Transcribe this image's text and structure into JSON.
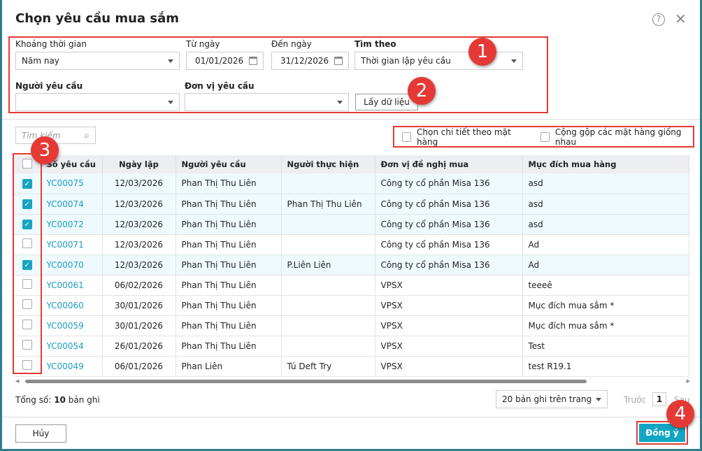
{
  "title": "Chọn yêu cầu mua sắm",
  "filters": {
    "period_label": "Khoảng thời gian",
    "period_value": "Năm nay",
    "from_label": "Từ ngày",
    "from_value": "01/01/2026",
    "to_label": "Đến ngày",
    "to_value": "31/12/2026",
    "search_by_label": "Tìm theo",
    "search_by_value": "Thời gian lập yêu cầu",
    "requester_label": "Người yêu cầu",
    "requester_value": "",
    "unit_label": "Đơn vị yêu cầu",
    "unit_value": "",
    "fetch_button": "Lấy dữ liệu"
  },
  "search_placeholder": "Tìm kiếm",
  "options": {
    "detail_by_item": "Chọn chi tiết theo mặt hàng",
    "merge_items": "Cộng gộp các mặt hàng giống nhau"
  },
  "columns": [
    "Số yêu cầu",
    "Ngày lập",
    "Người yêu cầu",
    "Người thực hiện",
    "Đơn vị đề nghị mua",
    "Mục đích mua hàng"
  ],
  "rows": [
    {
      "checked": true,
      "code": "YC00075",
      "date": "12/03/2026",
      "requester": "Phan Thị Thu Liên",
      "executor": "",
      "unit": "Công ty cổ phần Misa 136",
      "purpose": "asd"
    },
    {
      "checked": true,
      "code": "YC00074",
      "date": "12/03/2026",
      "requester": "Phan Thị Thu Liên",
      "executor": "Phan Thị Thu Liên",
      "unit": "Công ty cổ phần Misa 136",
      "purpose": "asd"
    },
    {
      "checked": true,
      "code": "YC00072",
      "date": "12/03/2026",
      "requester": "Phan Thị Thu Liên",
      "executor": "",
      "unit": "Công ty cổ phần Misa 136",
      "purpose": "asd"
    },
    {
      "checked": false,
      "code": "YC00071",
      "date": "12/03/2026",
      "requester": "Phan Thị Thu Liên",
      "executor": "",
      "unit": "Công ty cổ phần Misa 136",
      "purpose": "Ad"
    },
    {
      "checked": true,
      "code": "YC00070",
      "date": "12/03/2026",
      "requester": "Phan Thị Thu Liên",
      "executor": "P.Liên Liên",
      "unit": "Công ty cổ phần Misa 136",
      "purpose": "Ad"
    },
    {
      "checked": false,
      "code": "YC00061",
      "date": "06/02/2026",
      "requester": "Phan Thị Thu Liên",
      "executor": "",
      "unit": "VPSX",
      "purpose": "teeeê"
    },
    {
      "checked": false,
      "code": "YC00060",
      "date": "30/01/2026",
      "requester": "Phan Thị Thu Liên",
      "executor": "",
      "unit": "VPSX",
      "purpose": "Mục đích mua sắm *"
    },
    {
      "checked": false,
      "code": "YC00059",
      "date": "30/01/2026",
      "requester": "Phan Thị Thu Liên",
      "executor": "",
      "unit": "VPSX",
      "purpose": "Mục đích mua sắm *"
    },
    {
      "checked": false,
      "code": "YC00054",
      "date": "26/01/2026",
      "requester": "Phan Thị Thu Liên",
      "executor": "",
      "unit": "VPSX",
      "purpose": "Test"
    },
    {
      "checked": false,
      "code": "YC00049",
      "date": "06/01/2026",
      "requester": "Phan Liên",
      "executor": "Tú Deft Try",
      "unit": "VPSX",
      "purpose": "test R19.1"
    }
  ],
  "footer": {
    "total_label": "Tổng số:",
    "total_value": "10",
    "total_suffix": "bản ghi",
    "page_size": "20 bản ghi trên trang",
    "prev": "Trước",
    "page": "1",
    "next": "Sau",
    "cancel": "Hủy",
    "ok": "Đồng ý"
  },
  "badges": [
    "1",
    "2",
    "3",
    "4"
  ]
}
